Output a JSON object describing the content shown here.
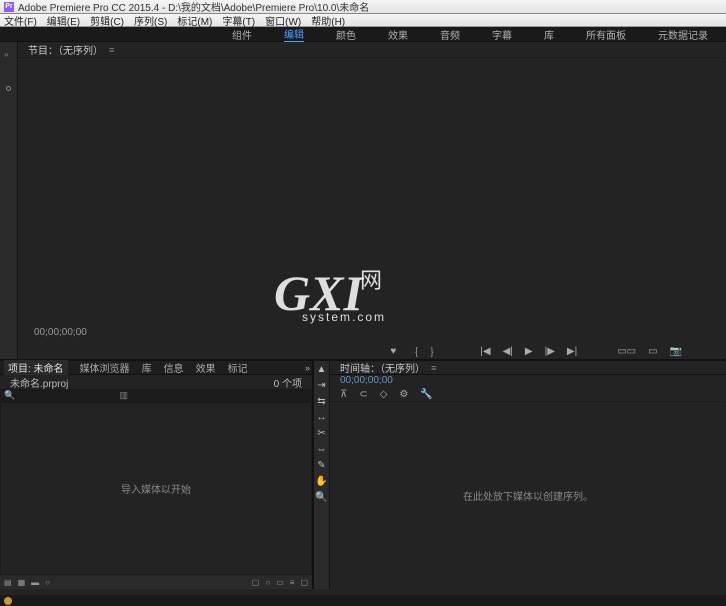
{
  "titlebar": {
    "icon_text": "Pr",
    "title": "Adobe Premiere Pro CC 2015.4 - D:\\我的文档\\Adobe\\Premiere Pro\\10.0\\未命名"
  },
  "menu": {
    "file": "文件(F)",
    "edit": "编辑(E)",
    "clip": "剪辑(C)",
    "sequence": "序列(S)",
    "marker": "标记(M)",
    "title": "字幕(T)",
    "window": "窗口(W)",
    "help": "帮助(H)"
  },
  "workspace": {
    "assembly": "组件",
    "editing": "编辑",
    "color": "颜色",
    "effects": "效果",
    "audio": "音频",
    "titles": "字幕",
    "libraries": "库",
    "all_panels": "所有面板",
    "metadata": "元数据记录"
  },
  "monitor": {
    "tab_label": "节目：（无序列）",
    "timecode": "00;00;00;00",
    "controls": {
      "mark_in": "♥",
      "in": "｛",
      "out": "｝",
      "goto_in": "|◀",
      "step_back": "◀|",
      "play": "▶",
      "step_fwd": "|▶",
      "goto_out": "▶|",
      "lift": "▭▭",
      "extract": "▭",
      "export": "📷"
    }
  },
  "project": {
    "tabs": {
      "project": "项目: 未命名",
      "media": "媒体浏览器",
      "lib": "库",
      "info": "信息",
      "effects": "效果",
      "markers": "标记"
    },
    "name_label": "未命名.prproj",
    "item_count": "0 个项",
    "body_msg": "导入媒体以开始",
    "footer": {
      "list": "▤",
      "icon": "▦",
      "slider": "▬",
      "sort": "○",
      "b1": "▢",
      "b2": "○",
      "b3": "▭",
      "b4": "≡",
      "b5": "▢"
    }
  },
  "tools": {
    "selection": "▲",
    "track_select": "⇥",
    "ripple": "⇆",
    "rate": "↔",
    "razor": "✂",
    "slip": "⇔",
    "pen": "✎",
    "hand": "✋",
    "zoom": "🔍"
  },
  "timeline": {
    "tab_label": "时间轴：（无序列）",
    "timecode": "00;00;00;00",
    "icons": {
      "snap": "⊼",
      "link": "⊂",
      "marker": "◇",
      "settings": "⚙",
      "wrench": "🔧"
    },
    "body_msg": "在此处放下媒体以创建序列。"
  },
  "watermark": {
    "gxi": "GXI",
    "wang": "网",
    "domain": "system.com"
  }
}
